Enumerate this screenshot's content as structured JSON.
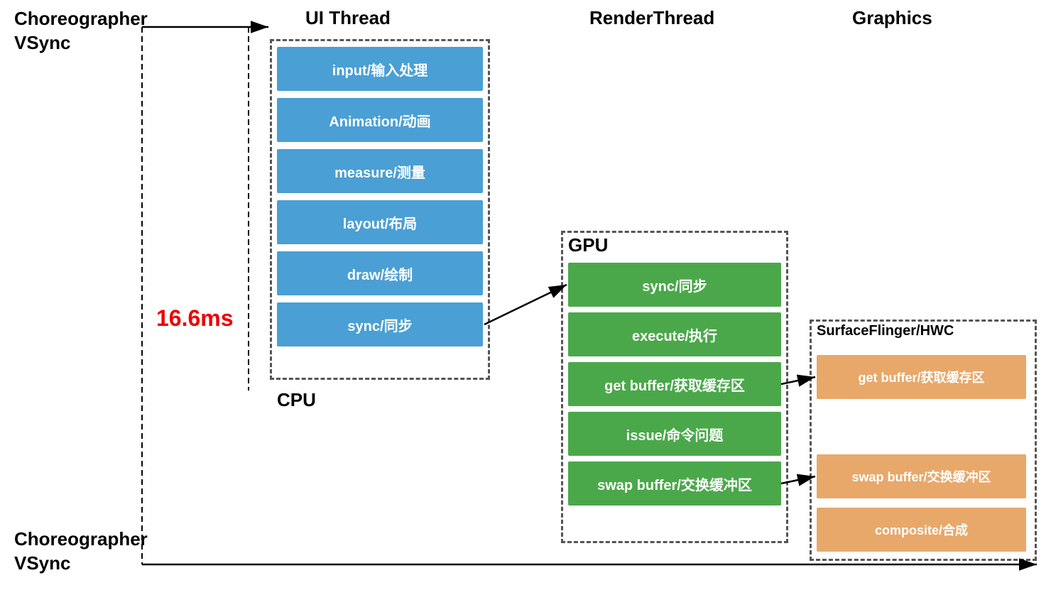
{
  "headers": {
    "vsync_top": "Choreographer\nVSync",
    "vsync_bottom": "Choreographer\nVSync",
    "ui_thread": "UI Thread",
    "render_thread": "RenderThread",
    "graphics": "Graphics"
  },
  "timing": "16.6ms",
  "labels": {
    "cpu": "CPU",
    "gpu": "GPU",
    "sf": "SurfaceFlinger/HWC"
  },
  "cpu_blocks": [
    "input/输入处理",
    "Animation/动画",
    "measure/测量",
    "layout/布局",
    "draw/绘制",
    "sync/同步"
  ],
  "gpu_blocks": [
    "sync/同步",
    "execute/执行",
    "get buffer/获取缓存区",
    "issue/命令问题",
    "swap buffer/交换缓冲区"
  ],
  "sf_blocks": [
    "get buffer/获取缓存区",
    "swap buffer/交换缓冲区",
    "composite/合成"
  ]
}
